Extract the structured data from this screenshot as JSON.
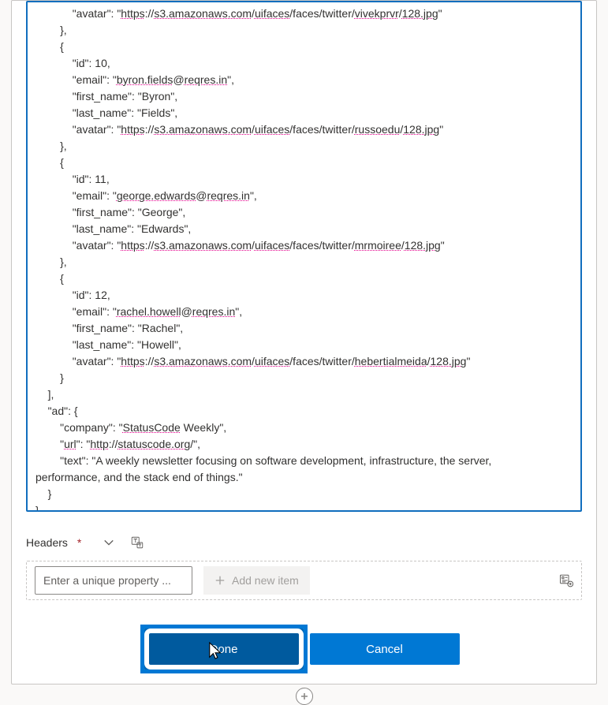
{
  "body_segments": [
    {
      "indent": 3,
      "parts": [
        {
          "t": "\"avatar\": \""
        },
        {
          "t": "https",
          "sp": true
        },
        {
          "t": "://"
        },
        {
          "t": "s3.amazonaws.com",
          "sp": true
        },
        {
          "t": "/"
        },
        {
          "t": "uifaces",
          "sp": true
        },
        {
          "t": "/faces/twitter/"
        },
        {
          "t": "vivekprvr",
          "sp": true
        },
        {
          "t": "/"
        },
        {
          "t": "128.jpg",
          "sp": true
        },
        {
          "t": "\""
        }
      ]
    },
    {
      "indent": 2,
      "parts": [
        {
          "t": "},"
        }
      ]
    },
    {
      "indent": 2,
      "parts": [
        {
          "t": "{"
        }
      ]
    },
    {
      "indent": 3,
      "parts": [
        {
          "t": "\"id\": 10,"
        }
      ]
    },
    {
      "indent": 3,
      "parts": [
        {
          "t": "\"email\": \""
        },
        {
          "t": "byron.fields",
          "sp": true
        },
        {
          "t": "@"
        },
        {
          "t": "reqres.in",
          "sp": true
        },
        {
          "t": "\","
        }
      ]
    },
    {
      "indent": 3,
      "parts": [
        {
          "t": "\"first_name\": \"Byron\","
        }
      ]
    },
    {
      "indent": 3,
      "parts": [
        {
          "t": "\"last_name\": \"Fields\","
        }
      ]
    },
    {
      "indent": 3,
      "parts": [
        {
          "t": "\"avatar\": \""
        },
        {
          "t": "https",
          "sp": true
        },
        {
          "t": "://"
        },
        {
          "t": "s3.amazonaws.com",
          "sp": true
        },
        {
          "t": "/"
        },
        {
          "t": "uifaces",
          "sp": true
        },
        {
          "t": "/faces/twitter/"
        },
        {
          "t": "russoedu",
          "sp": true
        },
        {
          "t": "/"
        },
        {
          "t": "128.jpg",
          "sp": true
        },
        {
          "t": "\""
        }
      ]
    },
    {
      "indent": 2,
      "parts": [
        {
          "t": "},"
        }
      ]
    },
    {
      "indent": 2,
      "parts": [
        {
          "t": "{"
        }
      ]
    },
    {
      "indent": 3,
      "parts": [
        {
          "t": "\"id\": 11,"
        }
      ]
    },
    {
      "indent": 3,
      "parts": [
        {
          "t": "\"email\": \""
        },
        {
          "t": "george.edwards",
          "sp": true
        },
        {
          "t": "@"
        },
        {
          "t": "reqres.in",
          "sp": true
        },
        {
          "t": "\","
        }
      ]
    },
    {
      "indent": 3,
      "parts": [
        {
          "t": "\"first_name\": \"George\","
        }
      ]
    },
    {
      "indent": 3,
      "parts": [
        {
          "t": "\"last_name\": \"Edwards\","
        }
      ]
    },
    {
      "indent": 3,
      "parts": [
        {
          "t": "\"avatar\": \""
        },
        {
          "t": "https",
          "sp": true
        },
        {
          "t": "://"
        },
        {
          "t": "s3.amazonaws.com",
          "sp": true
        },
        {
          "t": "/"
        },
        {
          "t": "uifaces",
          "sp": true
        },
        {
          "t": "/faces/twitter/"
        },
        {
          "t": "mrmoiree",
          "sp": true
        },
        {
          "t": "/"
        },
        {
          "t": "128.jpg",
          "sp": true
        },
        {
          "t": "\""
        }
      ]
    },
    {
      "indent": 2,
      "parts": [
        {
          "t": "},"
        }
      ]
    },
    {
      "indent": 2,
      "parts": [
        {
          "t": "{"
        }
      ]
    },
    {
      "indent": 3,
      "parts": [
        {
          "t": "\"id\": 12,"
        }
      ]
    },
    {
      "indent": 3,
      "parts": [
        {
          "t": "\"email\": \""
        },
        {
          "t": "rachel.howell",
          "sp": true
        },
        {
          "t": "@"
        },
        {
          "t": "reqres.in",
          "sp": true
        },
        {
          "t": "\","
        }
      ]
    },
    {
      "indent": 3,
      "parts": [
        {
          "t": "\"first_name\": \"Rachel\","
        }
      ]
    },
    {
      "indent": 3,
      "parts": [
        {
          "t": "\"last_name\": \"Howell\","
        }
      ]
    },
    {
      "indent": 3,
      "parts": [
        {
          "t": "\"avatar\": \""
        },
        {
          "t": "https",
          "sp": true
        },
        {
          "t": "://"
        },
        {
          "t": "s3.amazonaws.com",
          "sp": true
        },
        {
          "t": "/"
        },
        {
          "t": "uifaces",
          "sp": true
        },
        {
          "t": "/faces/twitter/"
        },
        {
          "t": "hebertialmeida",
          "sp": true
        },
        {
          "t": "/"
        },
        {
          "t": "128.jpg",
          "sp": true
        },
        {
          "t": "\""
        }
      ]
    },
    {
      "indent": 2,
      "parts": [
        {
          "t": "}"
        }
      ]
    },
    {
      "indent": 1,
      "parts": [
        {
          "t": "],"
        }
      ]
    },
    {
      "indent": 1,
      "parts": [
        {
          "t": "\"ad\": {"
        }
      ]
    },
    {
      "indent": 2,
      "parts": [
        {
          "t": "\"company\": \""
        },
        {
          "t": "StatusCode",
          "sp": true
        },
        {
          "t": " Weekly\","
        }
      ]
    },
    {
      "indent": 2,
      "parts": [
        {
          "t": "\""
        },
        {
          "t": "url",
          "sp": true
        },
        {
          "t": "\": \""
        },
        {
          "t": "http",
          "sp": true
        },
        {
          "t": "://"
        },
        {
          "t": "statuscode.org",
          "sp": true
        },
        {
          "t": "/\","
        }
      ]
    },
    {
      "indent": 2,
      "parts": [
        {
          "t": "\"text\": \"A weekly newsletter focusing on software development, infrastructure, the server,"
        }
      ],
      "wrap": true
    },
    {
      "indent": 0,
      "parts": [
        {
          "t": "performance, and the stack end of things.\""
        }
      ]
    },
    {
      "indent": 1,
      "parts": [
        {
          "t": "}"
        }
      ]
    },
    {
      "indent": 0,
      "parts": [
        {
          "t": "}"
        }
      ]
    }
  ],
  "headers": {
    "label": "Headers",
    "required_mark": "*",
    "property_placeholder": "Enter a unique property ...",
    "add_item_label": "Add new item"
  },
  "footer": {
    "done": "Done",
    "cancel": "Cancel"
  }
}
